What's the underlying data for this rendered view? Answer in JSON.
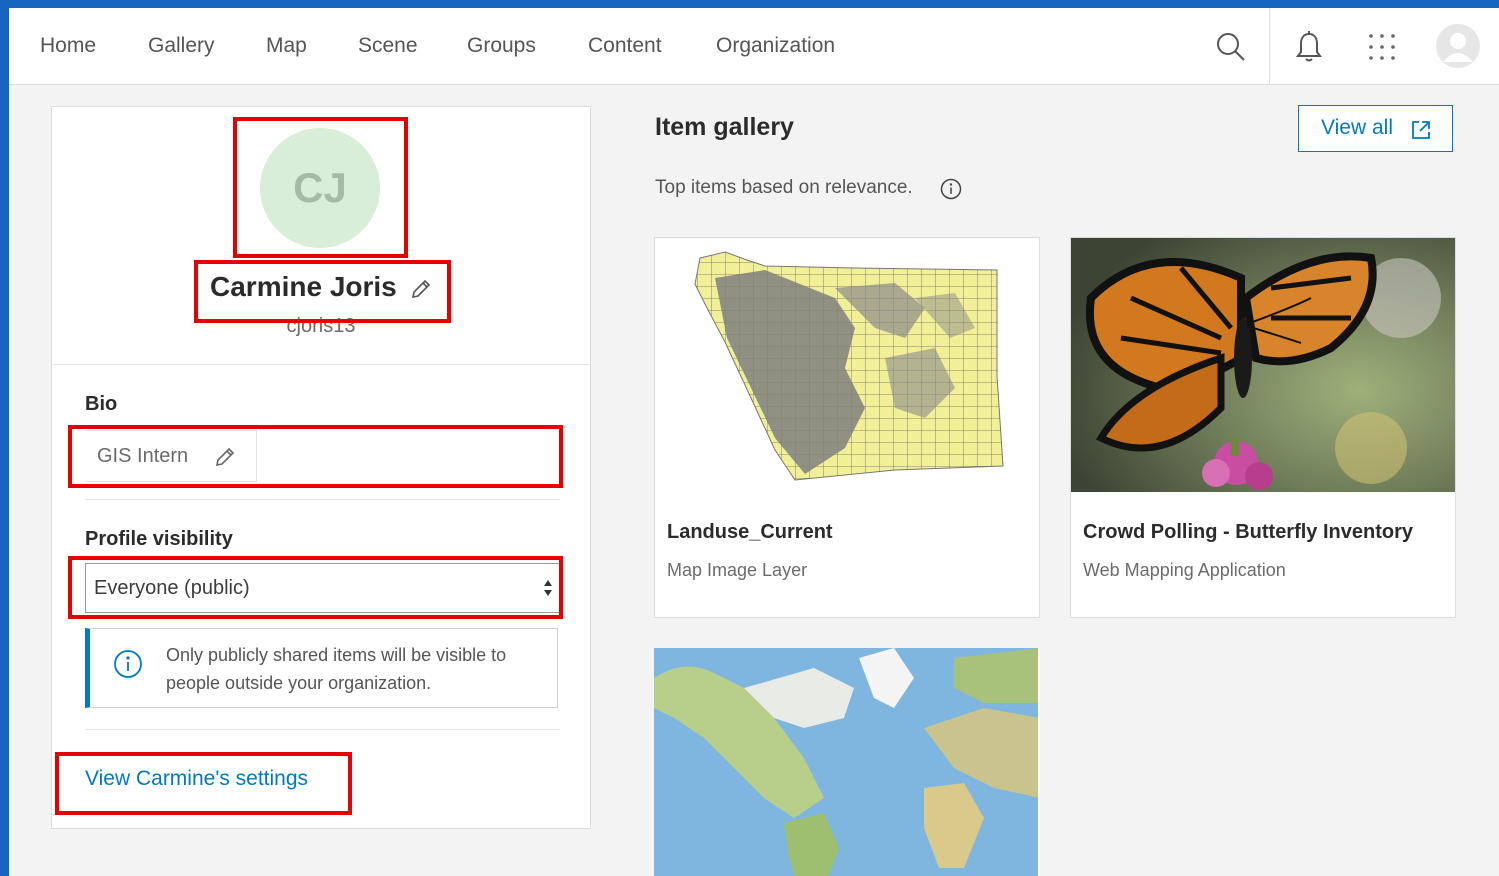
{
  "nav": {
    "items": [
      {
        "label": "Home"
      },
      {
        "label": "Gallery"
      },
      {
        "label": "Map"
      },
      {
        "label": "Scene"
      },
      {
        "label": "Groups"
      },
      {
        "label": "Content"
      },
      {
        "label": "Organization"
      }
    ],
    "icons": [
      "search-icon",
      "bell-icon",
      "app-launcher-icon",
      "user-avatar-icon"
    ]
  },
  "profile": {
    "initials": "CJ",
    "name": "Carmine Joris",
    "username": "cjoris13",
    "bio_label": "Bio",
    "bio_value": "GIS Intern",
    "visibility_label": "Profile visibility",
    "visibility_value": "Everyone (public)",
    "notice": "Only publicly shared items will be visible to people outside your organization.",
    "settings_link": "View Carmine's settings"
  },
  "gallery": {
    "title": "Item gallery",
    "subtitle": "Top items based on relevance.",
    "view_all": "View all",
    "items": [
      {
        "title": "Landuse_Current",
        "type": "Map Image Layer"
      },
      {
        "title": "Crowd Polling - Butterfly Inventory",
        "type": "Web Mapping Application"
      },
      {
        "title": "",
        "type": ""
      }
    ]
  },
  "colors": {
    "accent": "#0079c1",
    "highlight": "#e60000",
    "background": "#1565c0",
    "avatar_bg": "#d8eed8"
  }
}
